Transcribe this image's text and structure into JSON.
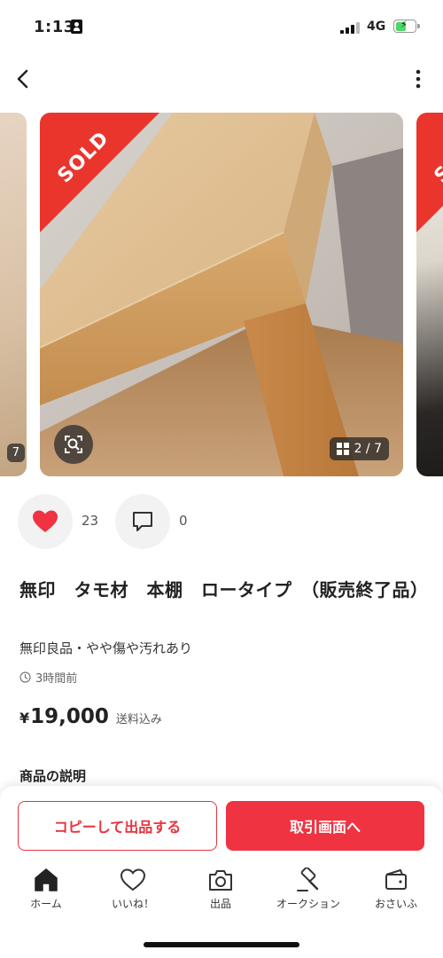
{
  "status_bar": {
    "time": "1:13",
    "network": "4G"
  },
  "carousel": {
    "sold_label": "SOLD",
    "prev_counter": "7",
    "counter": "2 / 7"
  },
  "stats": {
    "likes": "23",
    "comments": "0"
  },
  "product": {
    "title": "無印　タモ材　本棚　ロータイプ　（販売終了品）",
    "condition": "無印良品・やや傷や汚れあり",
    "posted": "3時間前",
    "price_currency": "¥",
    "price": "19,000",
    "shipping": "送料込み",
    "description_heading": "商品の説明"
  },
  "buttons": {
    "copy": "コピーして出品する",
    "trade": "取引画面へ"
  },
  "tabbar": {
    "items": [
      {
        "label": "ホーム",
        "icon": "home-icon"
      },
      {
        "label": "いいね！",
        "icon": "heart-icon"
      },
      {
        "label": "出品",
        "icon": "camera-icon"
      },
      {
        "label": "オークション",
        "icon": "gavel-icon"
      },
      {
        "label": "おさいふ",
        "icon": "wallet-icon"
      }
    ]
  },
  "colors": {
    "accent": "#ea352d",
    "like": "#ef3341"
  }
}
